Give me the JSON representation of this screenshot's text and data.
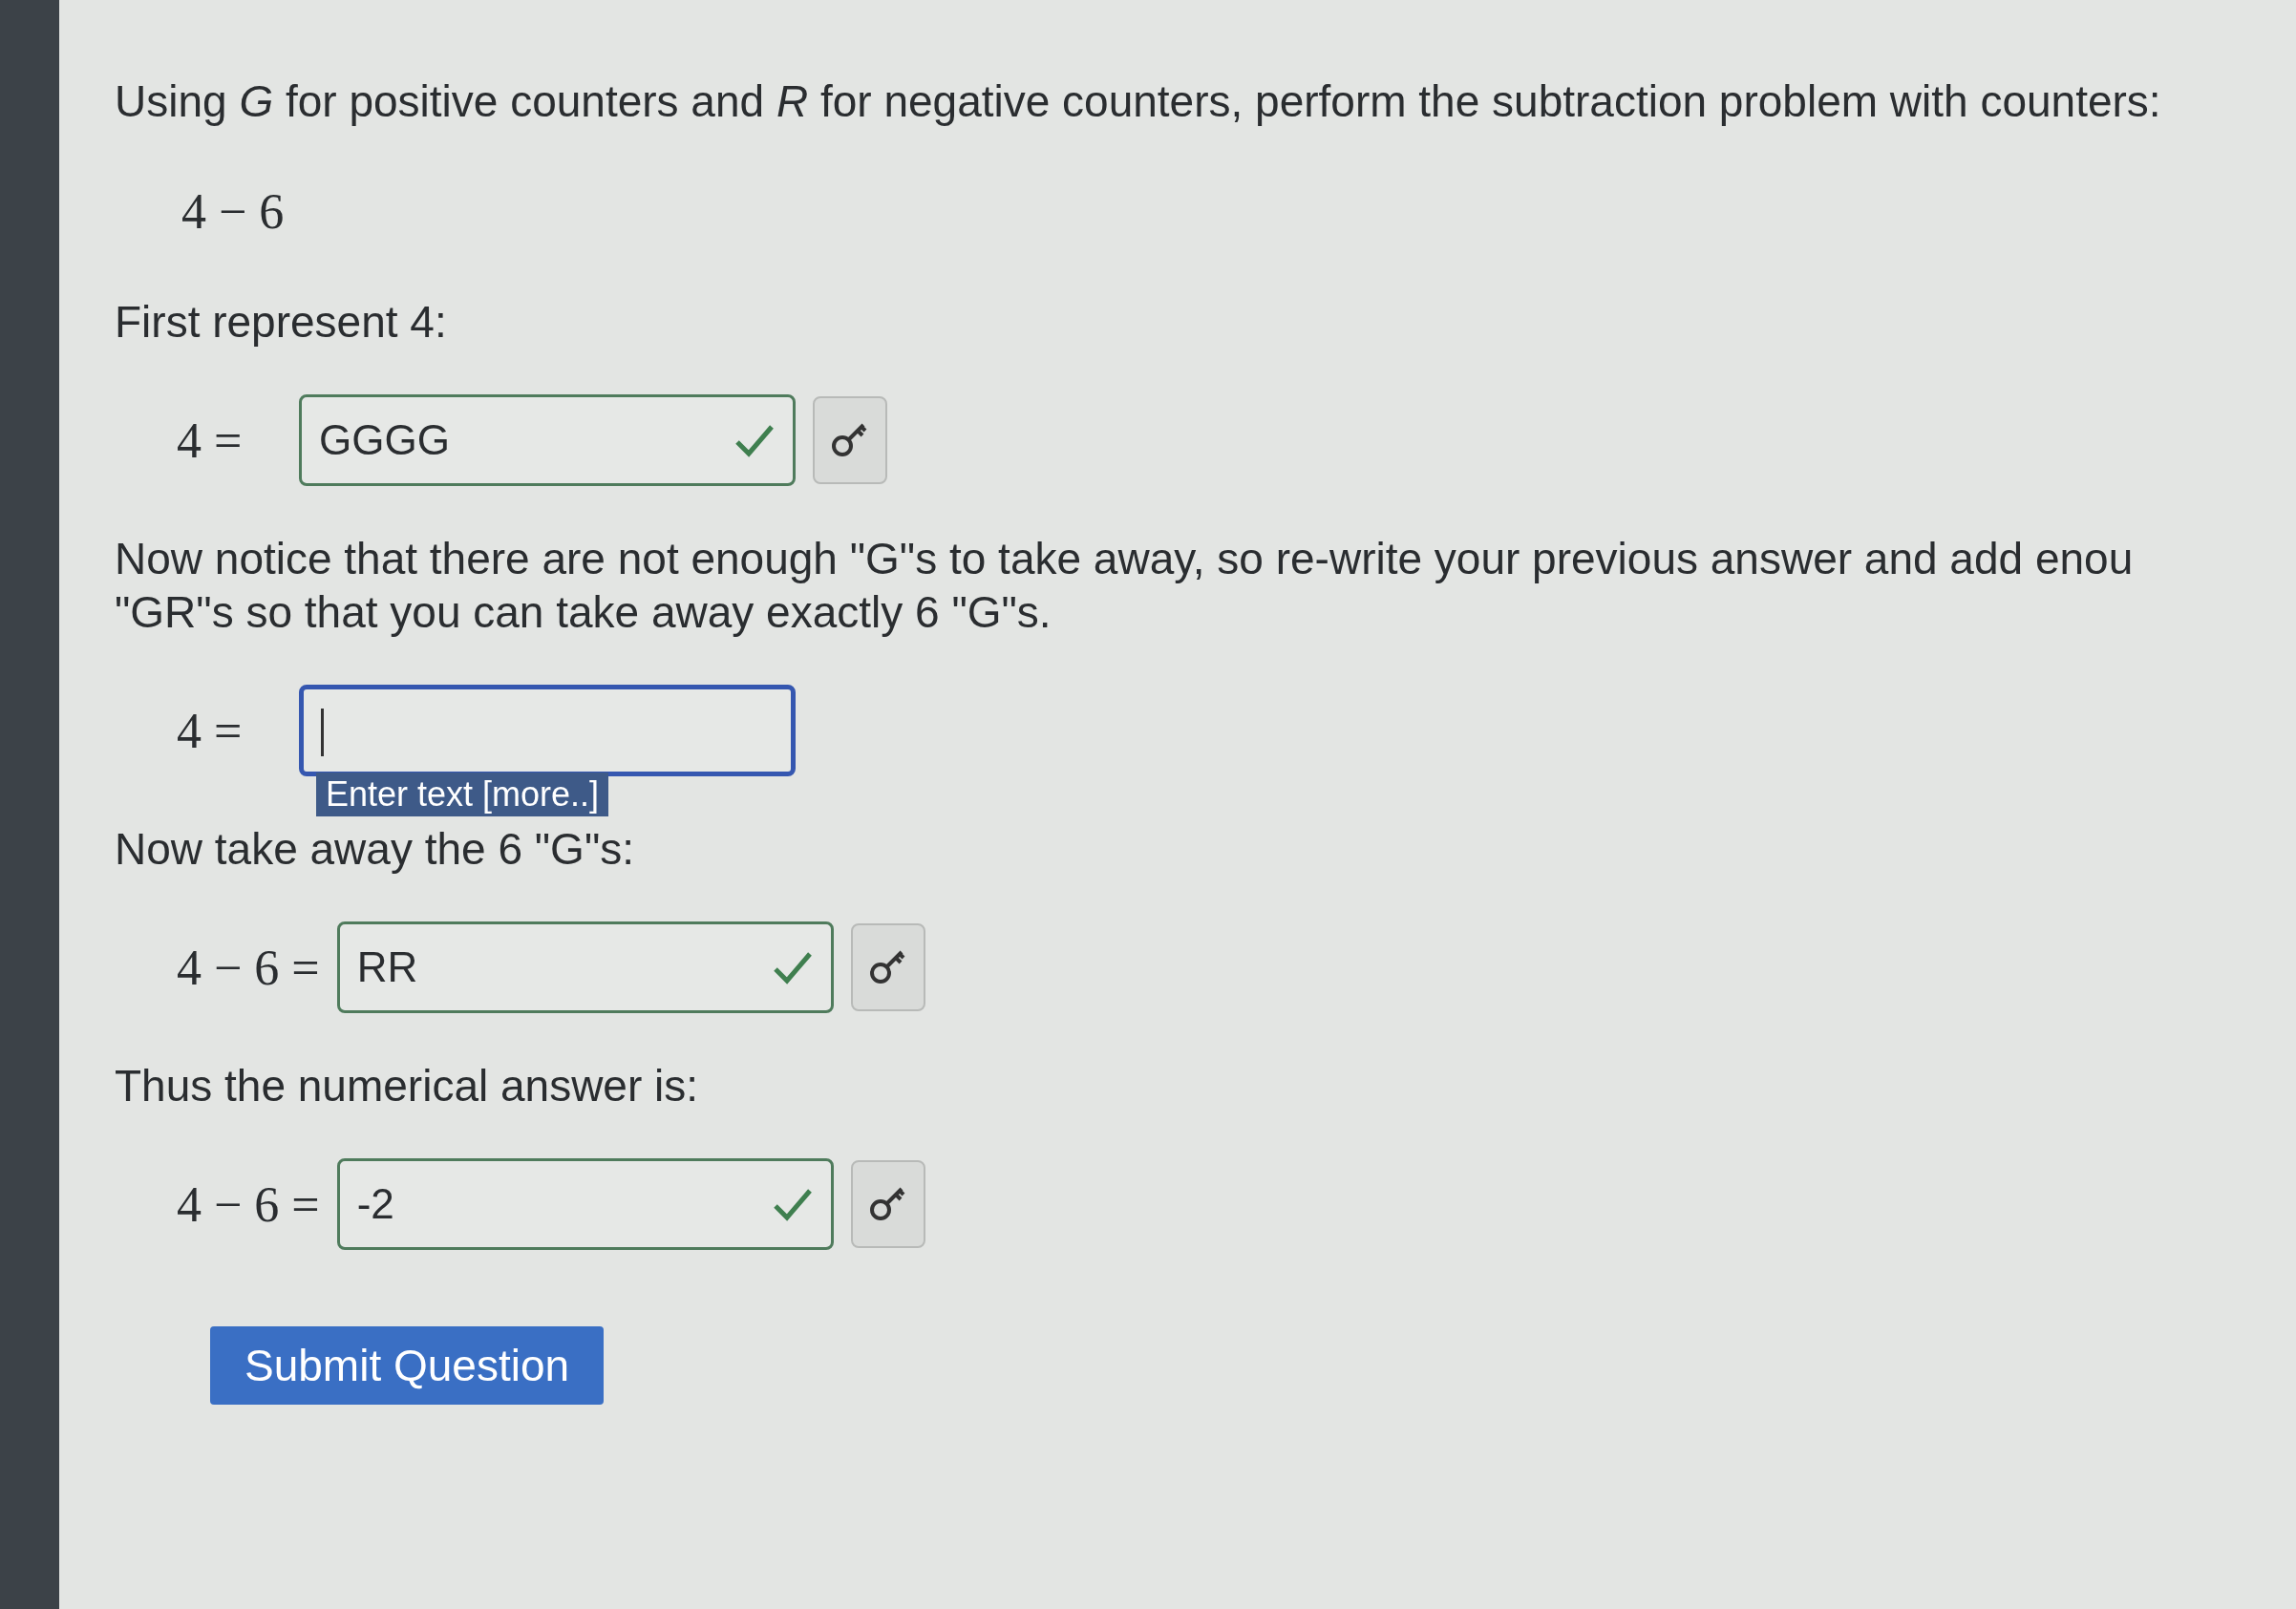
{
  "items": [
    {
      "kind": "text",
      "lines": [
        "Using *G* for positive counters and *R* for negative counters, perform the subtraction problem with counters:"
      ]
    },
    {
      "kind": "math",
      "text": "4 − 6"
    },
    {
      "kind": "text",
      "lines": [
        "First represent 4:"
      ]
    },
    {
      "kind": "answer",
      "label": "4 =",
      "value": "GGGG",
      "correct": true,
      "focused": false
    },
    {
      "kind": "text",
      "lines": [
        "Now notice that there are not enough \"G\"s to take away, so re-write your previous answer and add enou",
        "\"GR\"s so that you can take away exactly 6 \"G\"s."
      ]
    },
    {
      "kind": "answer",
      "label": "4 =",
      "value": "",
      "correct": false,
      "focused": true,
      "tooltip": "Enter text [more..]"
    },
    {
      "kind": "text",
      "lines": [
        "Now take away the 6 \"G\"s:"
      ]
    },
    {
      "kind": "answer",
      "label": "4 − 6 =",
      "value": "RR",
      "correct": true,
      "focused": false
    },
    {
      "kind": "text",
      "lines": [
        "Thus the numerical answer is:"
      ]
    },
    {
      "kind": "answer",
      "label": "4 − 6 =",
      "value": "-2",
      "correct": true,
      "focused": false
    },
    {
      "kind": "button",
      "text": "Submit Question"
    }
  ]
}
